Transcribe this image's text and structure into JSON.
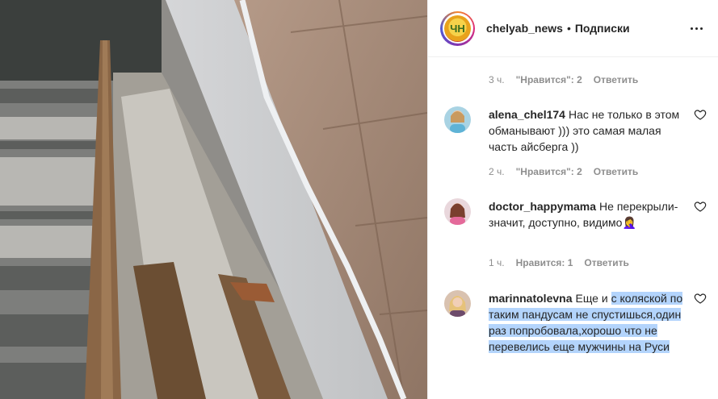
{
  "post": {
    "author": "chelyab_news",
    "separator": "•",
    "follow_label": "Подписки",
    "logo_text": "ЧН"
  },
  "comments_top_meta": {
    "time": "3 ч.",
    "likes": "\"Нравится\": 2",
    "reply": "Ответить"
  },
  "comments": [
    {
      "username": "alena_chel174",
      "text": "Нас не только в этом обманывают ))) это самая малая часть айсберга ))",
      "time": "2 ч.",
      "likes": "\"Нравится\": 2",
      "reply": "Ответить"
    },
    {
      "username": "doctor_happymama",
      "text": "Не перекрыли-значит, доступно, видимо🤦‍♀️",
      "time": "1 ч.",
      "likes": "Нравится: 1",
      "reply": "Ответить"
    },
    {
      "username": "marinnatolevna",
      "text_plain": "Еще и ",
      "text_highlighted": "с коляской по таким пандусам не спустишься,один раз попробовала,хорошо что не перевелись еще мужчины на Руси"
    }
  ],
  "colors": {
    "text": "#262626",
    "muted": "#8e8e8e",
    "selection": "#b3d4fc",
    "border": "#efefef"
  },
  "icons": {
    "more": "more-options-icon",
    "like": "heart-icon"
  }
}
